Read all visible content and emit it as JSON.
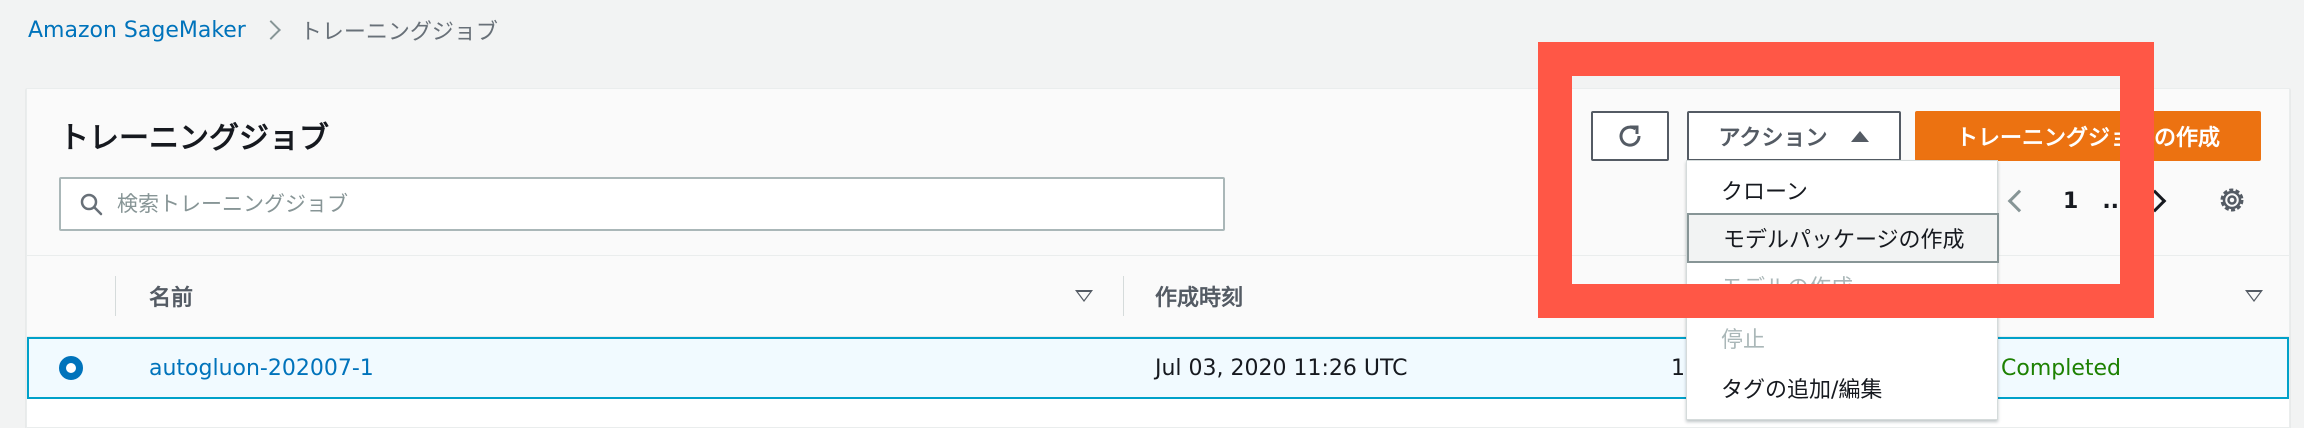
{
  "breadcrumb": {
    "root": "Amazon SageMaker",
    "current": "トレーニングジョブ"
  },
  "panel": {
    "title": "トレーニングジョブ",
    "search_placeholder": "検索トレーニングジョブ"
  },
  "toolbar": {
    "actions_label": "アクション",
    "create_label": "トレーニングジョブの作成"
  },
  "pagination": {
    "page": "1",
    "ellipsis": "..."
  },
  "table": {
    "columns": [
      "名前",
      "作成時刻"
    ],
    "rows": [
      {
        "name": "autogluon-202007-1",
        "created": "Jul 03, 2020 11:26 UTC",
        "duration_partial": "1",
        "status": "Completed",
        "selected": true
      }
    ]
  },
  "menu": {
    "items": [
      {
        "label": "クローン",
        "state": "normal"
      },
      {
        "label": "モデルパッケージの作成",
        "state": "highlighted"
      },
      {
        "label": "モデルの作成",
        "state": "disabled"
      },
      {
        "label": "停止",
        "state": "disabled"
      },
      {
        "label": "タグの追加/編集",
        "state": "normal"
      }
    ]
  },
  "colors": {
    "accent": "#ec7211",
    "link": "#0073bb",
    "status_ok": "#1d8102",
    "annotation": "#ff5746"
  },
  "icons": [
    "refresh-icon",
    "caret-up-icon",
    "search-icon",
    "chevron-left-icon",
    "chevron-right-icon",
    "gear-icon",
    "sort-desc-icon",
    "radio-selected-icon"
  ]
}
